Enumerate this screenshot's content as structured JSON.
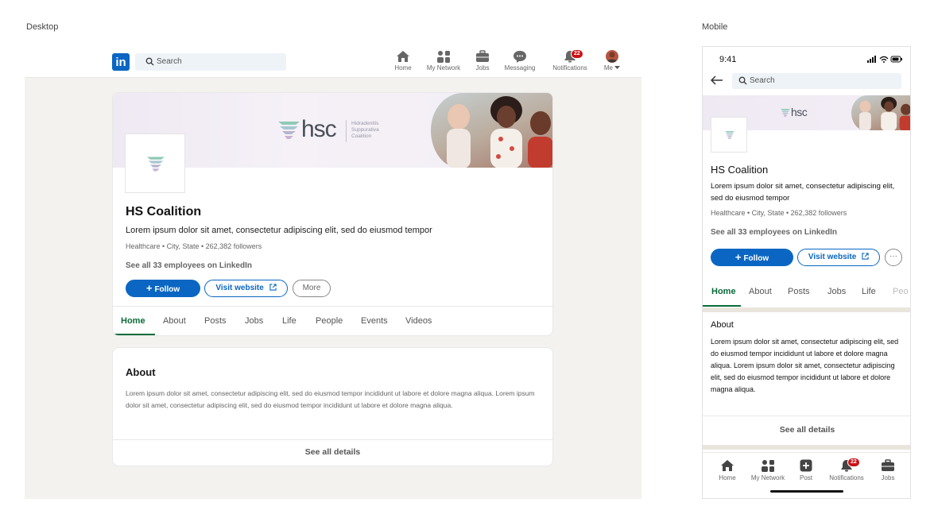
{
  "labels": {
    "desktop": "Desktop",
    "mobile": "Mobile"
  },
  "desktop": {
    "nav": {
      "logo": "in",
      "search_placeholder": "Search",
      "items": [
        {
          "label": "Home",
          "icon": "home-icon"
        },
        {
          "label": "My Network",
          "icon": "network-icon"
        },
        {
          "label": "Jobs",
          "icon": "briefcase-icon"
        },
        {
          "label": "Messaging",
          "icon": "messaging-icon"
        },
        {
          "label": "Notifications",
          "icon": "bell-icon",
          "badge": "22"
        },
        {
          "label": "Me",
          "icon": "avatar"
        }
      ]
    },
    "company": {
      "banner_logo_text": "hsc",
      "banner_logo_subtext": "Hidradenitis Suppurativa Coalition",
      "name": "HS Coalition",
      "tagline": "Lorem ipsum dolor sit amet, consectetur adipiscing elit, sed do eiusmod tempor",
      "meta": "Healthcare • City, State • 262,382 followers",
      "employees_link": "See all 33 employees on LinkedIn",
      "buttons": {
        "follow": "Follow",
        "website": "Visit website",
        "more": "More"
      },
      "tabs": [
        "Home",
        "About",
        "Posts",
        "Jobs",
        "Life",
        "People",
        "Events",
        "Videos"
      ],
      "active_tab": "Home"
    },
    "about": {
      "title": "About",
      "body": "Lorem ipsum dolor sit amet, consectetur adipiscing elit, sed do eiusmod tempor incididunt ut labore et dolore magna aliqua. Lorem ipsum dolor sit amet, consectetur adipiscing elit, sed do eiusmod tempor incididunt ut labore et dolore magna aliqua.",
      "see_all": "See all details"
    }
  },
  "mobile": {
    "status_time": "9:41",
    "search_placeholder": "Search",
    "company": {
      "name": "HS Coalition",
      "tagline": "Lorem ipsum dolor sit amet, consectetur adipiscing elit, sed do eiusmod tempor",
      "meta": "Healthcare • City, State • 262,382 followers",
      "employees_link": "See all 33 employees on LinkedIn",
      "buttons": {
        "follow": "Follow",
        "website": "Visit website",
        "more": "···"
      },
      "tabs": [
        "Home",
        "About",
        "Posts",
        "Jobs",
        "Life",
        "Peo"
      ]
    },
    "about": {
      "title": "About",
      "body": "Lorem ipsum dolor sit amet, consectetur adipiscing elit, sed do eiusmod tempor incididunt ut labore et dolore magna aliqua. Lorem ipsum dolor sit amet, consectetur adipiscing elit, sed do eiusmod tempor incididunt ut labore et dolore magna aliqua.",
      "see_all": "See all details"
    },
    "bottom_nav": [
      {
        "label": "Home",
        "icon": "home-icon"
      },
      {
        "label": "My Network",
        "icon": "network-icon"
      },
      {
        "label": "Post",
        "icon": "post-icon"
      },
      {
        "label": "Notifications",
        "icon": "bell-icon",
        "badge": "22"
      },
      {
        "label": "Jobs",
        "icon": "briefcase-icon"
      }
    ]
  },
  "colors": {
    "brand": "#0a66c2",
    "active_tab": "#0b6b3a",
    "badge": "#cc1016",
    "page_bg": "#f3f2ef"
  }
}
